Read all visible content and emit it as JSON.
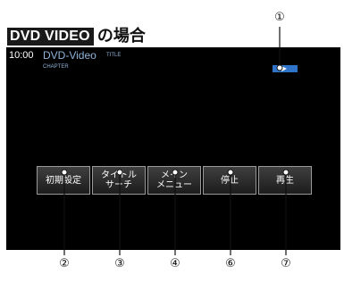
{
  "heading": {
    "badge": "DVD VIDEO",
    "suffix": "の場合"
  },
  "screen": {
    "clock": "10:00",
    "source": "DVD-Video",
    "title_label": "TITLE",
    "chapter_label": "CHAPTER",
    "play_status_icon": "play-icon",
    "play_status_color": "#2f74c8"
  },
  "buttons": [
    {
      "label": "初期設定"
    },
    {
      "label": "タイトル\nサーチ"
    },
    {
      "label": "メイン\nメニュー"
    },
    {
      "label": "停止"
    },
    {
      "label": "再生"
    }
  ],
  "callouts": {
    "play_status": "①",
    "initial_settings": "②",
    "title_search": "③",
    "main_menu": "④",
    "stop": "⑥",
    "play": "⑦"
  }
}
